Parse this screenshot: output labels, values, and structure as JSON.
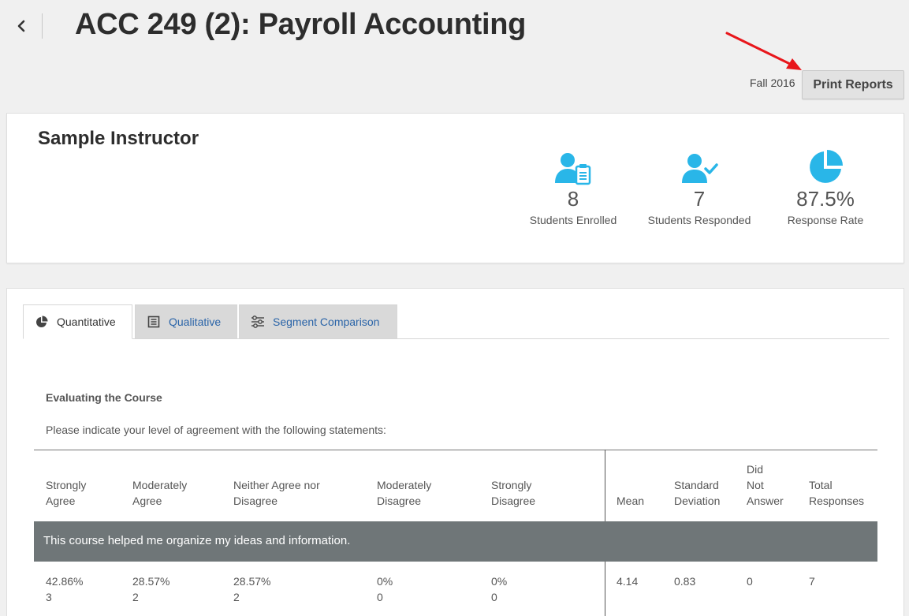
{
  "header": {
    "title": "ACC 249 (2): Payroll Accounting",
    "term": "Fall 2016",
    "print_label": "Print Reports"
  },
  "summary": {
    "instructor": "Sample Instructor",
    "stats": [
      {
        "icon": "person-clipboard-icon",
        "value": "8",
        "label": "Students Enrolled"
      },
      {
        "icon": "person-check-icon",
        "value": "7",
        "label": "Students Responded"
      },
      {
        "icon": "pie-chart-icon",
        "value": "87.5%",
        "label": "Response Rate"
      }
    ]
  },
  "tabs": [
    {
      "icon": "pie-chart-icon",
      "label": "Quantitative",
      "active": true
    },
    {
      "icon": "document-list-icon",
      "label": "Qualitative",
      "active": false
    },
    {
      "icon": "sliders-icon",
      "label": "Segment Comparison",
      "active": false
    }
  ],
  "section": {
    "title": "Evaluating the Course",
    "instructions": "Please indicate your level of agreement with the following statements:"
  },
  "table": {
    "headers": [
      [
        "Strongly",
        "Agree"
      ],
      [
        "Moderately",
        "Agree"
      ],
      [
        "Neither Agree nor",
        "Disagree"
      ],
      [
        "Moderately",
        "Disagree"
      ],
      [
        "Strongly",
        "Disagree"
      ],
      [
        "Mean"
      ],
      [
        "Standard",
        "Deviation"
      ],
      [
        "Did",
        "Not",
        "Answer"
      ],
      [
        "Total",
        "Responses"
      ]
    ],
    "question": "This course helped me organize my ideas and information.",
    "row": {
      "strongly_agree_pct": "42.86%",
      "strongly_agree_n": "3",
      "mod_agree_pct": "28.57%",
      "mod_agree_n": "2",
      "neither_pct": "28.57%",
      "neither_n": "2",
      "mod_disagree_pct": "0%",
      "mod_disagree_n": "0",
      "strongly_disagree_pct": "0%",
      "strongly_disagree_n": "0",
      "mean": "4.14",
      "std_dev": "0.83",
      "did_not_answer": "0",
      "total": "7"
    }
  },
  "colors": {
    "accent_icon": "#29b6e8",
    "link": "#2a64a8",
    "question_row": "#6f7678",
    "annotation_arrow": "#e8161b"
  }
}
